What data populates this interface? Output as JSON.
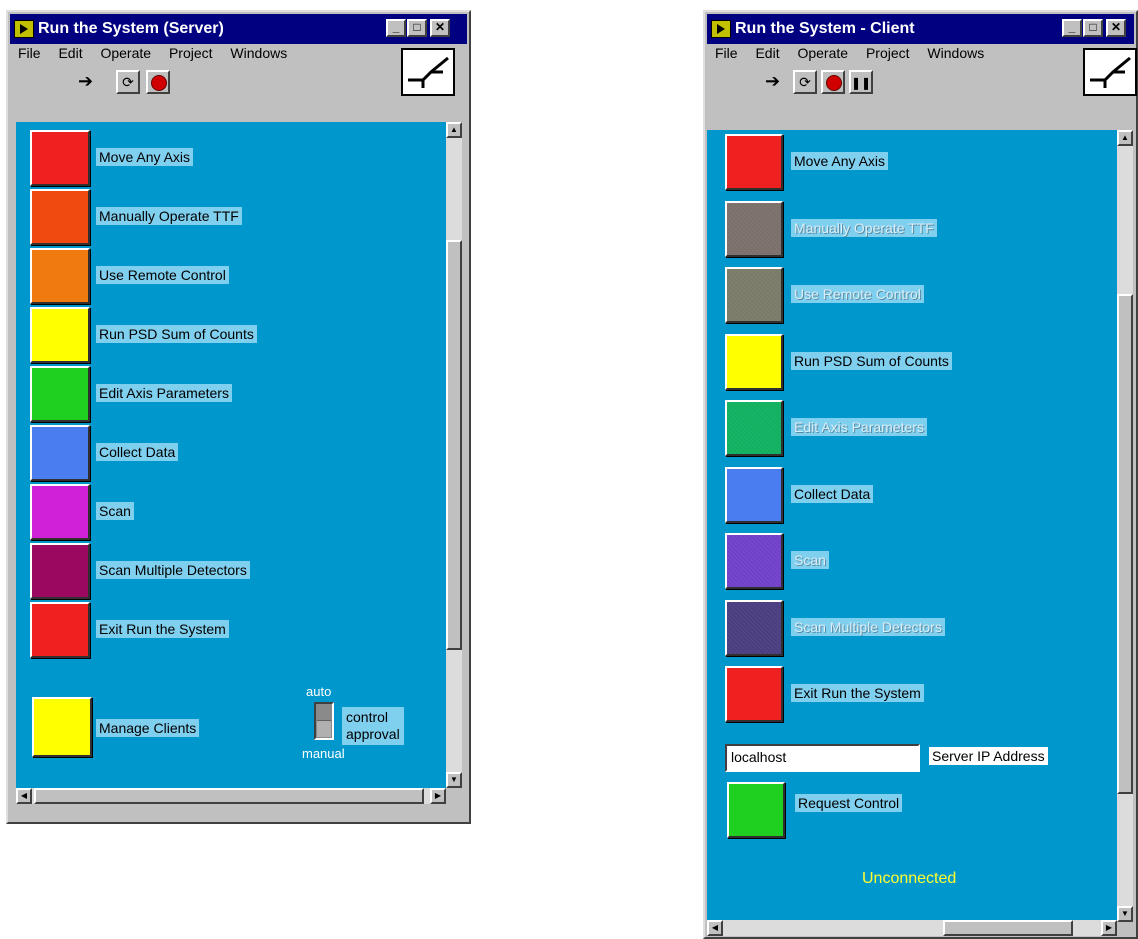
{
  "server": {
    "title": "Run the System (Server)",
    "menu": [
      "File",
      "Edit",
      "Operate",
      "Project",
      "Windows"
    ],
    "buttons": [
      {
        "label": "Move Any Axis",
        "color": "#ee2020"
      },
      {
        "label": "Manually Operate TTF",
        "color": "#f04a10"
      },
      {
        "label": "Use Remote Control",
        "color": "#f07a10"
      },
      {
        "label": "Run PSD Sum of Counts",
        "color": "#ffff00"
      },
      {
        "label": "Edit Axis Parameters",
        "color": "#20d020"
      },
      {
        "label": "Collect Data",
        "color": "#4a7ef0"
      },
      {
        "label": "Scan",
        "color": "#d020d8"
      },
      {
        "label": "Scan Multiple Detectors",
        "color": "#9a0860"
      },
      {
        "label": "Exit Run the System",
        "color": "#ee2020"
      }
    ],
    "manage_clients": {
      "label": "Manage Clients",
      "color": "#ffff00"
    },
    "switch": {
      "top": "auto",
      "bottom": "manual",
      "label": "control\napproval"
    }
  },
  "client": {
    "title": "Run the System - Client",
    "menu": [
      "File",
      "Edit",
      "Operate",
      "Project",
      "Windows"
    ],
    "buttons": [
      {
        "label": "Move Any Axis",
        "color": "#ee2020",
        "disabled": false
      },
      {
        "label": "Manually Operate TTF",
        "color": "#7a6f6a",
        "disabled": true
      },
      {
        "label": "Use Remote Control",
        "color": "#7a7a68",
        "disabled": true
      },
      {
        "label": "Run PSD Sum of Counts",
        "color": "#ffff00",
        "disabled": false
      },
      {
        "label": "Edit Axis Parameters",
        "color": "#10b060",
        "disabled": true
      },
      {
        "label": "Collect Data",
        "color": "#4a7ef0",
        "disabled": false
      },
      {
        "label": "Scan",
        "color": "#7040c8",
        "disabled": true
      },
      {
        "label": "Scan Multiple Detectors",
        "color": "#4a3d80",
        "disabled": true
      },
      {
        "label": "Exit Run the System",
        "color": "#ee2020",
        "disabled": false
      }
    ],
    "server_ip_value": "localhost",
    "server_ip_label": "Server IP Address",
    "request_control": {
      "label": "Request Control",
      "color": "#20d020"
    },
    "status": "Unconnected"
  }
}
